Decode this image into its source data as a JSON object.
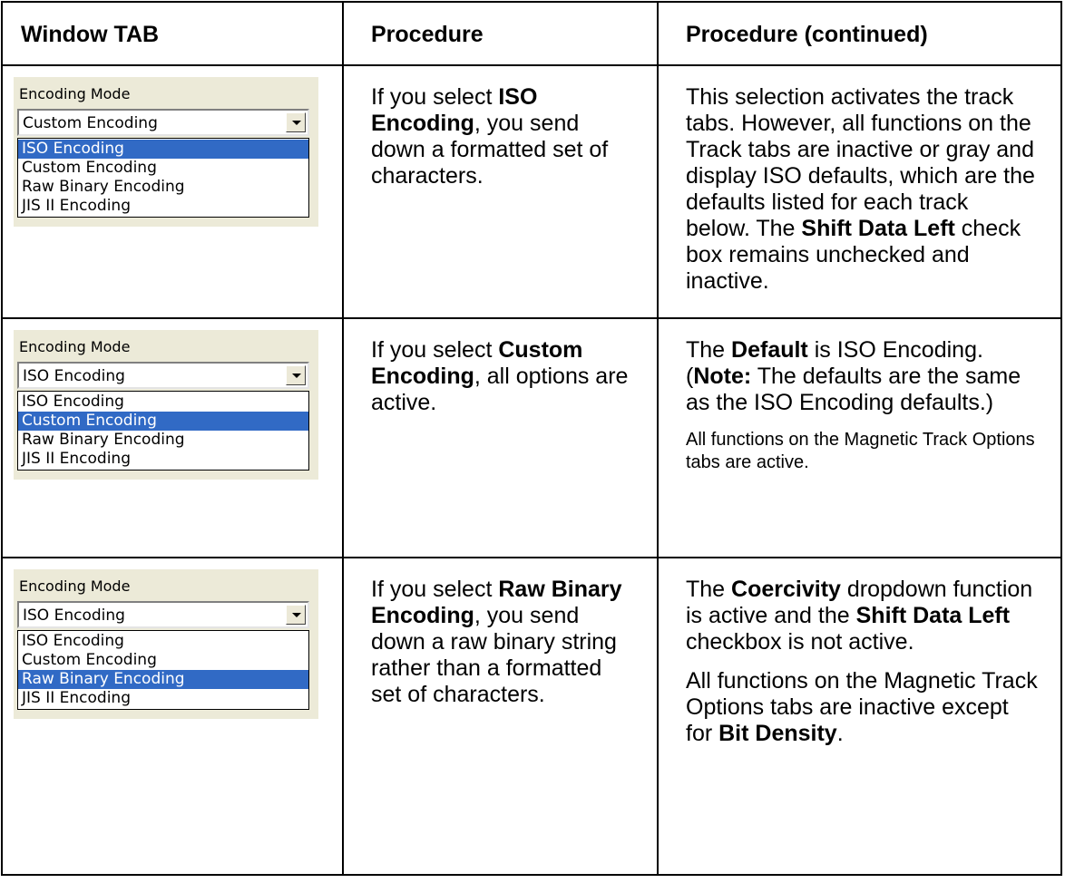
{
  "headers": [
    "Window TAB",
    "Procedure",
    "Procedure (continued)"
  ],
  "widget_label": "Encoding Mode",
  "options": [
    "ISO Encoding",
    "Custom Encoding",
    "Raw Binary Encoding",
    "JIS II Encoding"
  ],
  "rows": [
    {
      "combo_value": "Custom Encoding",
      "selected_option": "ISO Encoding",
      "proc": [
        {
          "t": "If you select "
        },
        {
          "t": "ISO Encoding",
          "b": true
        },
        {
          "t": ", you send down a formatted set of characters."
        }
      ],
      "cont": [
        [
          {
            "t": "This selection activates the track tabs. However, all functions on the Track tabs are inactive or gray and display ISO defaults, which are the defaults listed for each track below. The "
          },
          {
            "t": "Shift Data Left",
            "b": true
          },
          {
            "t": " check box remains unchecked and inactive."
          }
        ]
      ],
      "cont_small": []
    },
    {
      "combo_value": "ISO Encoding",
      "selected_option": "Custom Encoding",
      "proc": [
        {
          "t": "If you select "
        },
        {
          "t": "Custom Encoding",
          "b": true
        },
        {
          "t": ", all options are active."
        }
      ],
      "cont": [
        [
          {
            "t": "The "
          },
          {
            "t": "Default",
            "b": true
          },
          {
            "t": " is ISO Encoding. ("
          },
          {
            "t": "Note:",
            "b": true
          },
          {
            "t": "  The defaults are the same as the ISO Encoding defaults.)"
          }
        ]
      ],
      "cont_small": [
        [
          {
            "t": "All functions on the Magnetic Track Options tabs are active."
          }
        ]
      ]
    },
    {
      "combo_value": "ISO Encoding",
      "selected_option": "Raw Binary Encoding",
      "proc": [
        {
          "t": "If you select "
        },
        {
          "t": "Raw Binary Encoding",
          "b": true
        },
        {
          "t": ", you send down a raw binary string rather than a formatted set of characters."
        }
      ],
      "cont": [
        [
          {
            "t": "The "
          },
          {
            "t": "Coercivity",
            "b": true
          },
          {
            "t": " dropdown function is active and the "
          },
          {
            "t": "Shift Data Left",
            "b": true
          },
          {
            "t": " checkbox is not active."
          }
        ],
        [
          {
            "t": "All functions on the Magnetic Track Options tabs are inactive except for "
          },
          {
            "t": "Bit Density",
            "b": true
          },
          {
            "t": "."
          }
        ]
      ],
      "cont_small": []
    }
  ]
}
